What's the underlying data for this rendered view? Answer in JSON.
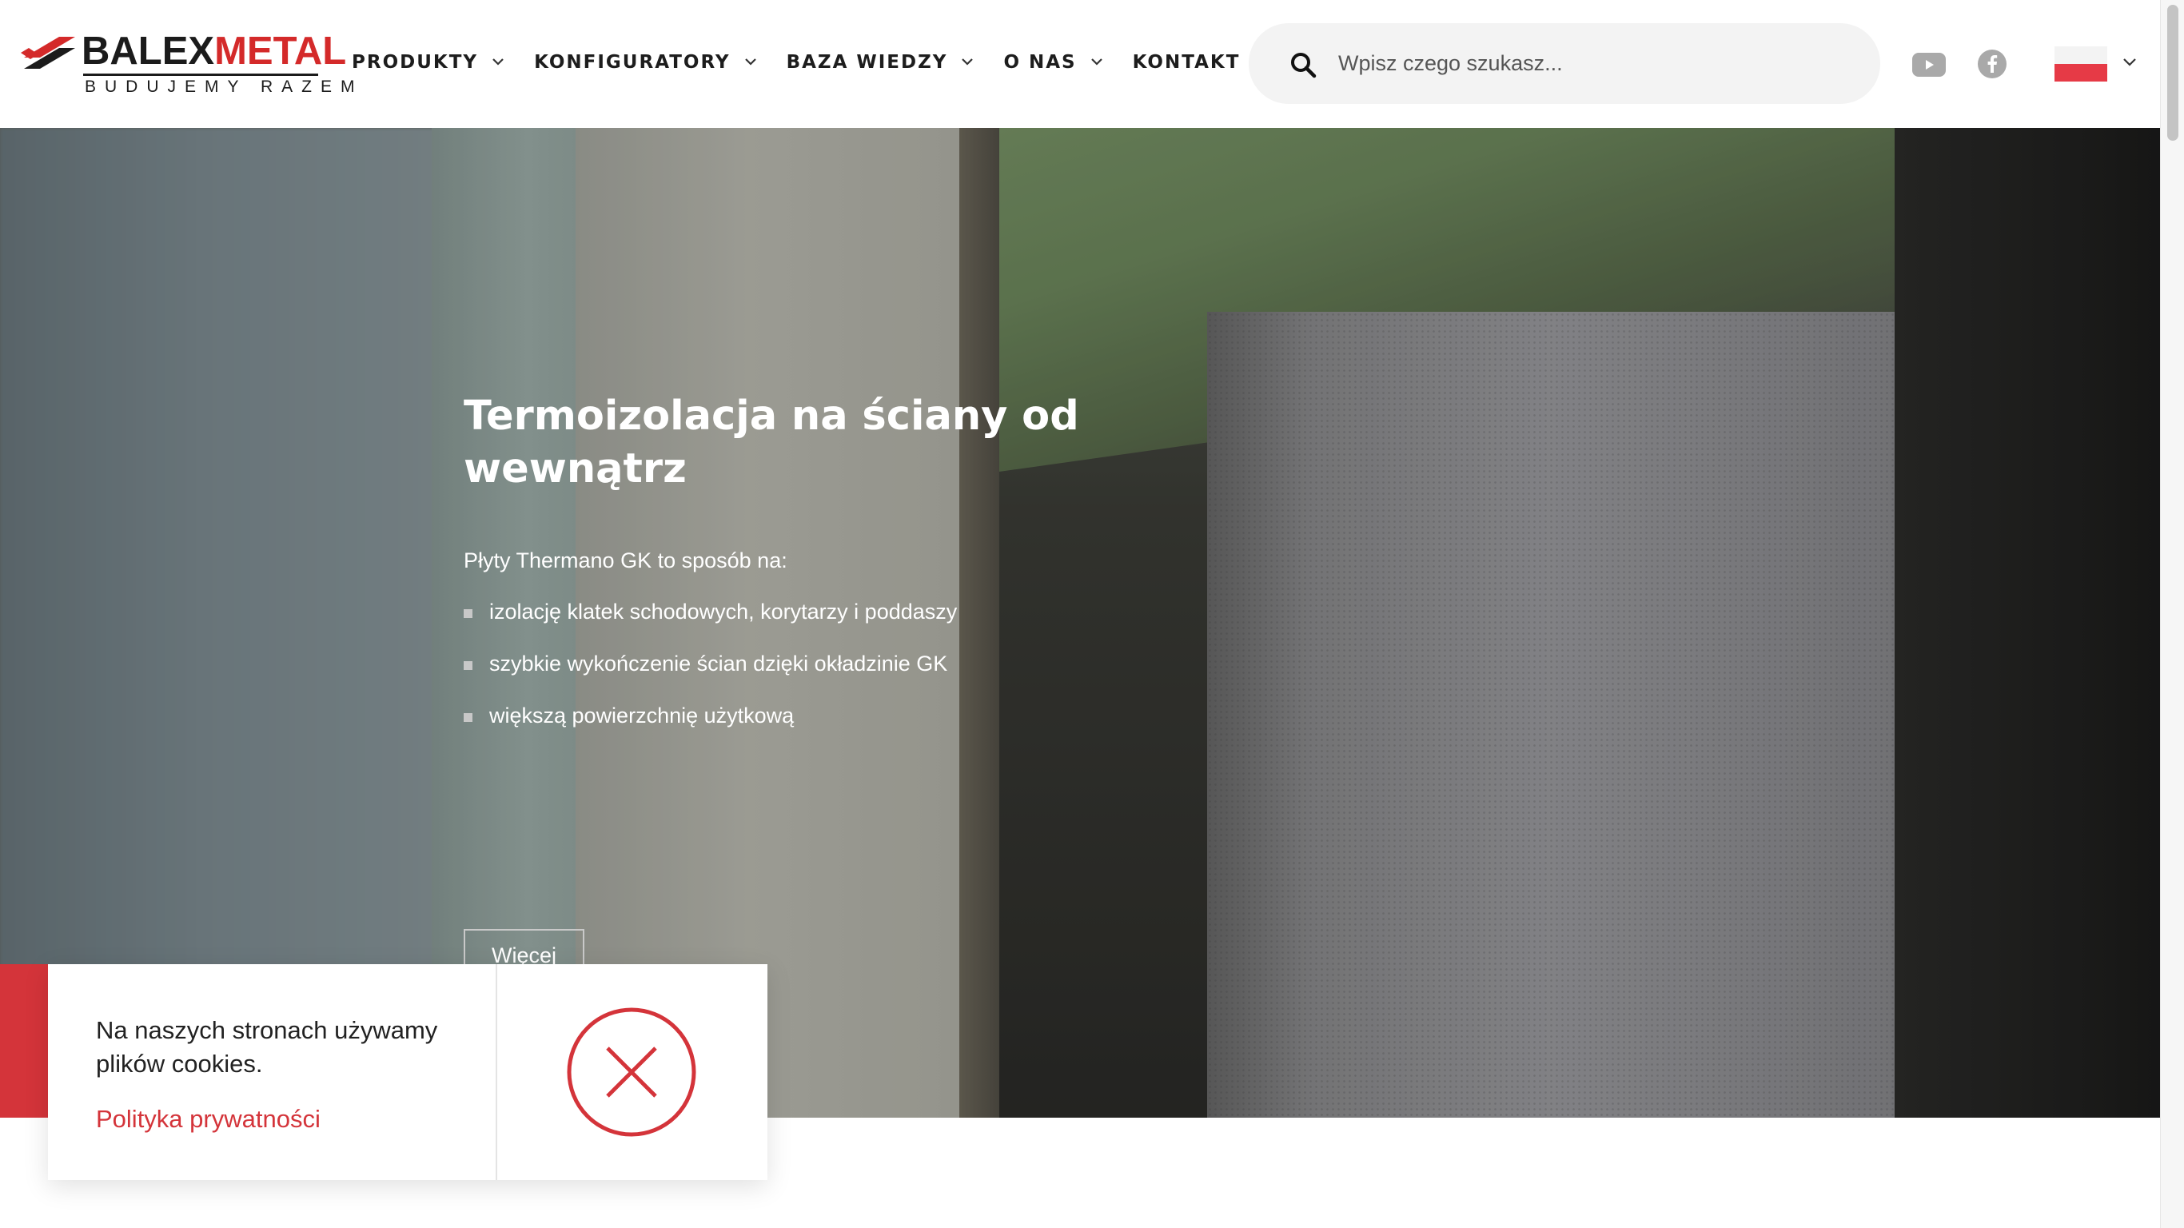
{
  "brand": {
    "name_part1": "BALEX",
    "name_part2": "METAL",
    "tagline": "BUDUJEMY RAZEM",
    "colors": {
      "red": "#d42a2a",
      "dark": "#1b1b1b"
    }
  },
  "nav": {
    "items": [
      {
        "label": "PRODUKTY",
        "icon": "chevron-down-icon"
      },
      {
        "label": "KONFIGURATORY",
        "icon": "chevron-down-icon"
      },
      {
        "label": "BAZA WIEDZY",
        "icon": "chevron-down-icon"
      },
      {
        "label": "O NAS",
        "icon": "chevron-down-icon"
      },
      {
        "label": "KONTAKT",
        "icon": "chevron-down-icon"
      }
    ]
  },
  "search": {
    "placeholder": "Wpisz czego szukasz...",
    "value": "",
    "icon": "search-icon"
  },
  "social": {
    "youtube_icon": "youtube-icon",
    "facebook_icon": "facebook-icon"
  },
  "language": {
    "selected": "pl",
    "flag_colors": [
      "#f3f3f3",
      "#e63a46"
    ]
  },
  "hero": {
    "title": "Termoizolacja na ściany od wewnątrz",
    "lead": "Płyty Thermano GK to sposób na:",
    "bullets": [
      "izolację klatek schodowych, korytarzy i poddaszy",
      "szybkie wykończenie ścian dzięki okładzinie GK",
      "większą powierzchnię użytkową"
    ],
    "button_label": "Więcej"
  },
  "cookie": {
    "text": "Na naszych stronach używamy plików cookies.",
    "link_label": "Polityka prywatności",
    "accent_color": "#d4343a",
    "close_icon": "close-circle-icon"
  }
}
